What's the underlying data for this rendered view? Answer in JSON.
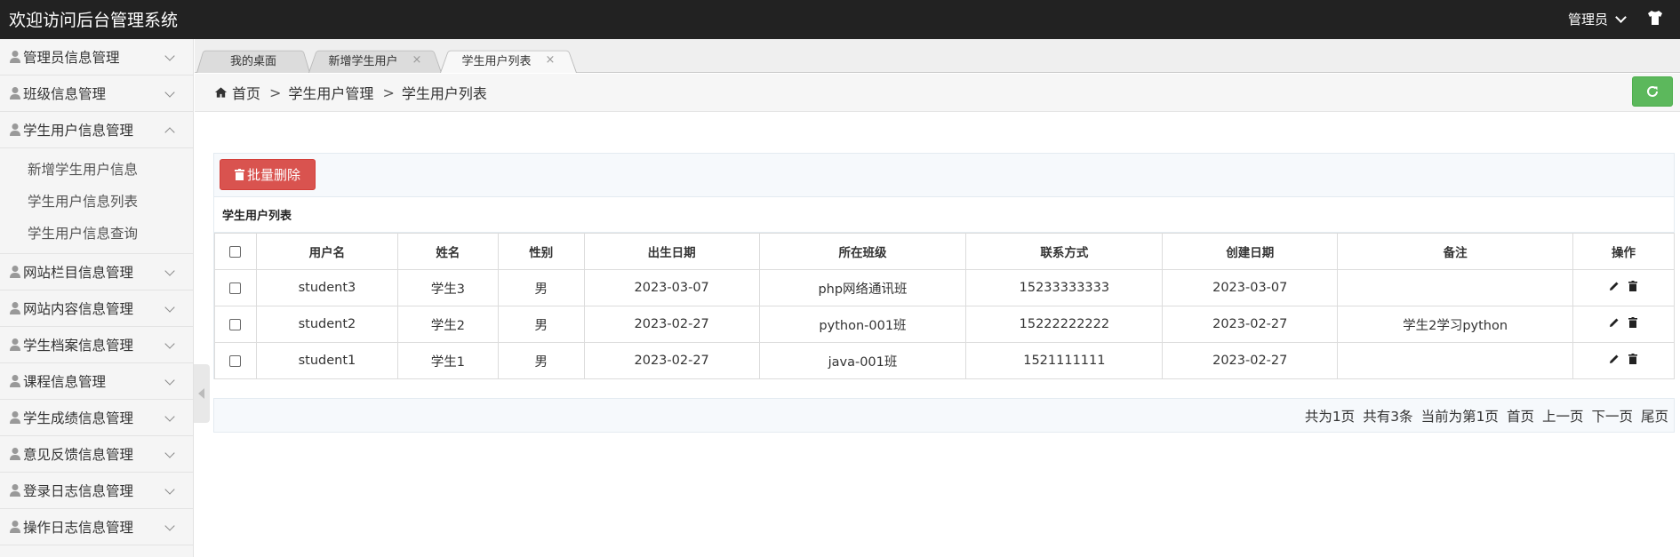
{
  "header": {
    "title": "欢迎访问后台管理系统",
    "user": "管理员"
  },
  "sidebar": {
    "items": [
      {
        "label": "管理员信息管理",
        "expanded": false
      },
      {
        "label": "班级信息管理",
        "expanded": false
      },
      {
        "label": "学生用户信息管理",
        "expanded": true,
        "children": [
          "新增学生用户信息",
          "学生用户信息列表",
          "学生用户信息查询"
        ]
      },
      {
        "label": "网站栏目信息管理",
        "expanded": false
      },
      {
        "label": "网站内容信息管理",
        "expanded": false
      },
      {
        "label": "学生档案信息管理",
        "expanded": false
      },
      {
        "label": "课程信息管理",
        "expanded": false
      },
      {
        "label": "学生成绩信息管理",
        "expanded": false
      },
      {
        "label": "意见反馈信息管理",
        "expanded": false
      },
      {
        "label": "登录日志信息管理",
        "expanded": false
      },
      {
        "label": "操作日志信息管理",
        "expanded": false
      }
    ]
  },
  "tabs": [
    {
      "label": "我的桌面",
      "closable": false,
      "active": false
    },
    {
      "label": "新增学生用户",
      "closable": true,
      "active": false
    },
    {
      "label": "学生用户列表",
      "closable": true,
      "active": true
    }
  ],
  "tab_close_glyph": "×",
  "breadcrumb": {
    "home": "首页",
    "items": [
      "学生用户管理",
      "学生用户列表"
    ],
    "separator": ">"
  },
  "toolbar": {
    "batch_delete_label": "批量删除"
  },
  "table": {
    "title": "学生用户列表",
    "columns": [
      "用户名",
      "姓名",
      "性别",
      "出生日期",
      "所在班级",
      "联系方式",
      "创建日期",
      "备注",
      "操作"
    ],
    "rows": [
      {
        "username": "student3",
        "name": "学生3",
        "gender": "男",
        "birth": "2023-03-07",
        "class": "php网络通讯班",
        "phone": "15233333333",
        "created": "2023-03-07",
        "note": ""
      },
      {
        "username": "student2",
        "name": "学生2",
        "gender": "男",
        "birth": "2023-02-27",
        "class": "python-001班",
        "phone": "15222222222",
        "created": "2023-02-27",
        "note": "学生2学习python"
      },
      {
        "username": "student1",
        "name": "学生1",
        "gender": "男",
        "birth": "2023-02-27",
        "class": "java-001班",
        "phone": "1521111111",
        "created": "2023-02-27",
        "note": ""
      }
    ]
  },
  "pagination": {
    "total_pages": "共为1页",
    "total_items": "共有3条",
    "current": "当前为第1页",
    "first": "首页",
    "prev": "上一页",
    "next": "下一页",
    "last": "尾页"
  },
  "colors": {
    "header_bg": "#222222",
    "danger": "#d9534f",
    "success": "#5cb85c"
  },
  "icons": [
    "shirt-icon",
    "person-icon",
    "home-icon",
    "refresh-icon",
    "trash-icon",
    "pencil-icon",
    "chevron-down-icon",
    "chevron-up-icon"
  ]
}
